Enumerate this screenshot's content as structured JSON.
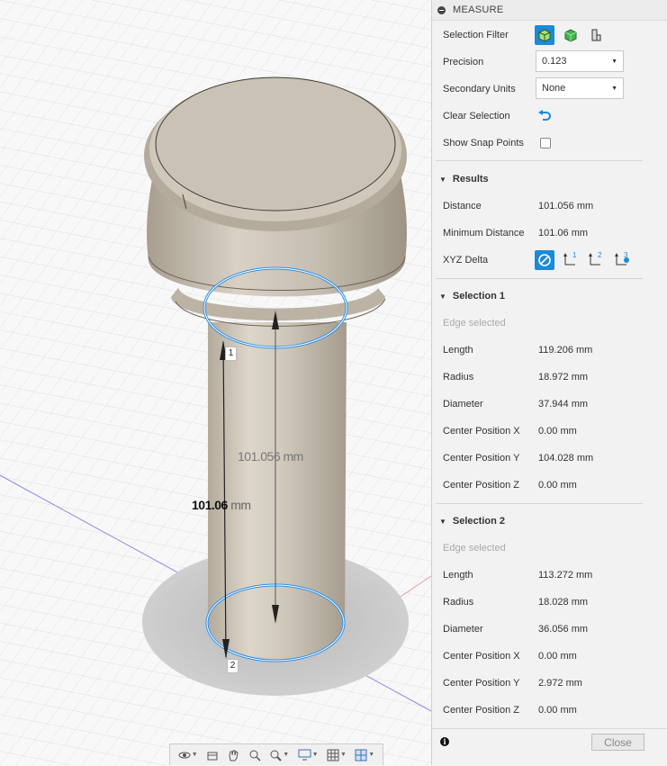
{
  "viewport": {
    "dim_long": "101.056 mm",
    "dim_short_value": "101.06",
    "dim_short_unit": " mm",
    "point1": "1",
    "point2": "2"
  },
  "toolbar": {
    "items": [
      "orbit-icon",
      "look-at-icon",
      "pan-icon",
      "zoom-fit-icon",
      "zoom-icon",
      "display-settings-icon",
      "grid-icon",
      "viewports-icon"
    ]
  },
  "panel": {
    "title": "MEASURE",
    "selection_filter_label": "Selection Filter",
    "precision_label": "Precision",
    "precision_value": "0.123",
    "secondary_units_label": "Secondary Units",
    "secondary_units_value": "None",
    "clear_selection_label": "Clear Selection",
    "show_snap_points_label": "Show Snap Points",
    "results": {
      "heading": "Results",
      "distance_label": "Distance",
      "distance_value": "101.056 mm",
      "min_distance_label": "Minimum Distance",
      "min_distance_value": "101.06 mm",
      "xyz_delta_label": "XYZ Delta",
      "xyz_axes": [
        "1",
        "2",
        "3"
      ]
    },
    "selection1": {
      "heading": "Selection 1",
      "type": "Edge selected",
      "length_label": "Length",
      "length_value": "119.206 mm",
      "radius_label": "Radius",
      "radius_value": "18.972 mm",
      "diameter_label": "Diameter",
      "diameter_value": "37.944 mm",
      "cx_label": "Center Position X",
      "cx_value": "0.00 mm",
      "cy_label": "Center Position Y",
      "cy_value": "104.028 mm",
      "cz_label": "Center Position Z",
      "cz_value": "0.00 mm"
    },
    "selection2": {
      "heading": "Selection 2",
      "type": "Edge selected",
      "length_label": "Length",
      "length_value": "113.272 mm",
      "radius_label": "Radius",
      "radius_value": "18.028 mm",
      "diameter_label": "Diameter",
      "diameter_value": "36.056 mm",
      "cx_label": "Center Position X",
      "cx_value": "0.00 mm",
      "cy_label": "Center Position Y",
      "cy_value": "2.972 mm",
      "cz_label": "Center Position Z",
      "cz_value": "0.00 mm"
    },
    "close_label": "Close"
  },
  "colors": {
    "accent": "#1b8ad8",
    "selection_edge": "#2d8fe6",
    "model": "#c9c1b2"
  }
}
